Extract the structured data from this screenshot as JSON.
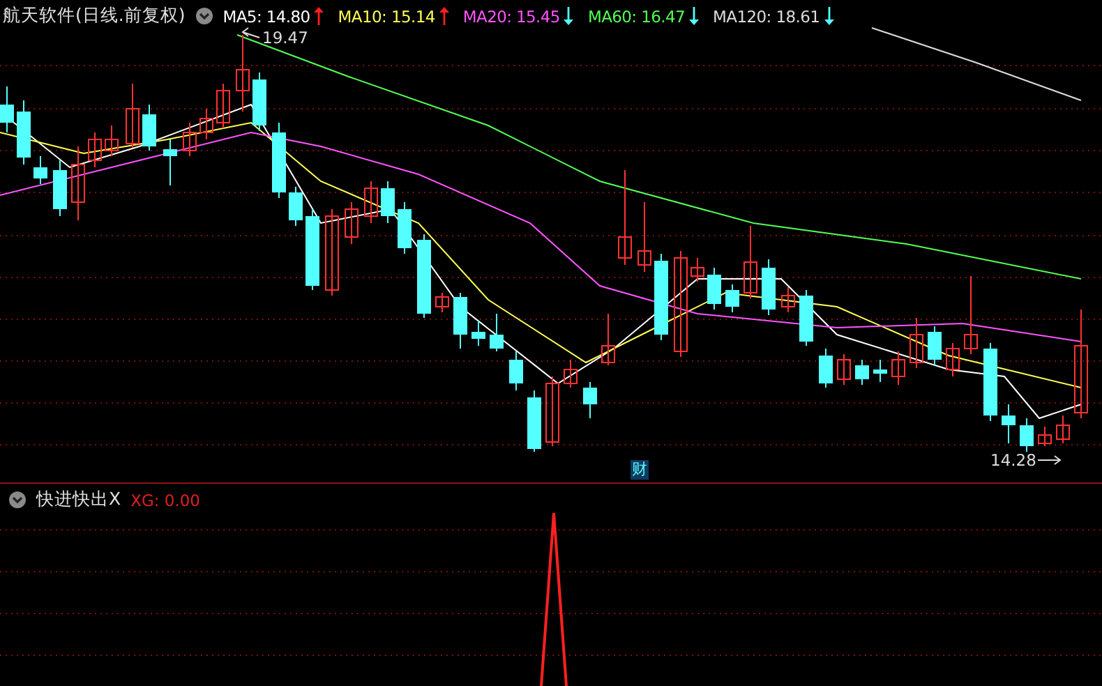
{
  "header": {
    "title": "航天软件(日线.前复权)",
    "indicators": [
      {
        "label": "MA5:",
        "value": "14.80",
        "rising": true,
        "color": "#ffffff"
      },
      {
        "label": "MA10:",
        "value": "15.14",
        "rising": true,
        "color": "#ffff54"
      },
      {
        "label": "MA20:",
        "value": "15.45",
        "rising": false,
        "color": "#ff54ff"
      },
      {
        "label": "MA60:",
        "value": "16.47",
        "rising": false,
        "color": "#54ff54"
      },
      {
        "label": "MA120:",
        "value": "18.61",
        "rising": false,
        "color": "#dcdcdc"
      }
    ]
  },
  "price_chart": {
    "high_label": "19.47",
    "low_label": "14.28",
    "event_badge": "财"
  },
  "indicator_panel": {
    "title": "快进快出X",
    "output": {
      "label": "XG:",
      "value": "0.00"
    }
  }
}
